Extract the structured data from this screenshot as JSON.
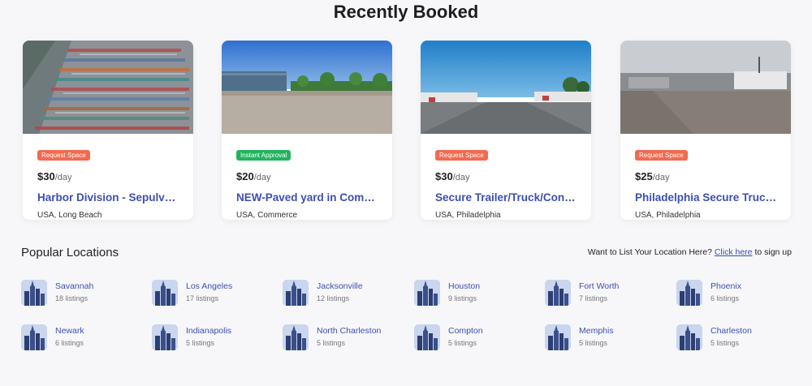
{
  "section_title": "Recently Booked",
  "cards": [
    {
      "badge": "Request Space",
      "badge_color": "#f26a4f",
      "price": "$30",
      "unit": "/day",
      "title": "Harbor Division - Sepulveda…",
      "location": "USA, Long Beach"
    },
    {
      "badge": "Instant Approval",
      "badge_color": "#22b35e",
      "price": "$20",
      "unit": "/day",
      "title": "NEW-Paved yard in Commerce…",
      "location": "USA, Commerce"
    },
    {
      "badge": "Request Space",
      "badge_color": "#f26a4f",
      "price": "$30",
      "unit": "/day",
      "title": "Secure Trailer/Truck/Container…",
      "location": "USA, Philadelphia"
    },
    {
      "badge": "Request Space",
      "badge_color": "#f26a4f",
      "price": "$25",
      "unit": "/day",
      "title": "Philadelphia Secure Truck…",
      "location": "USA, Philadelphia"
    }
  ],
  "popular": {
    "title": "Popular Locations",
    "cta_prefix": "Want to List Your Location Here?",
    "cta_link": "Click here",
    "cta_suffix": "to sign up",
    "locations": [
      {
        "name": "Savannah",
        "count": "18 listings"
      },
      {
        "name": "Los Angeles",
        "count": "17 listings"
      },
      {
        "name": "Jacksonville",
        "count": "12 listings"
      },
      {
        "name": "Houston",
        "count": "9 listings"
      },
      {
        "name": "Fort Worth",
        "count": "7 listings"
      },
      {
        "name": "Phoenix",
        "count": "6 listings"
      },
      {
        "name": "Newark",
        "count": "6 listings"
      },
      {
        "name": "Indianapolis",
        "count": "5 listings"
      },
      {
        "name": "North Charleston",
        "count": "5 listings"
      },
      {
        "name": "Compton",
        "count": "5 listings"
      },
      {
        "name": "Memphis",
        "count": "5 listings"
      },
      {
        "name": "Charleston",
        "count": "5 listings"
      }
    ]
  },
  "colors": {
    "accent": "#3d4fb0",
    "request": "#f26a4f",
    "instant": "#22b35e"
  }
}
